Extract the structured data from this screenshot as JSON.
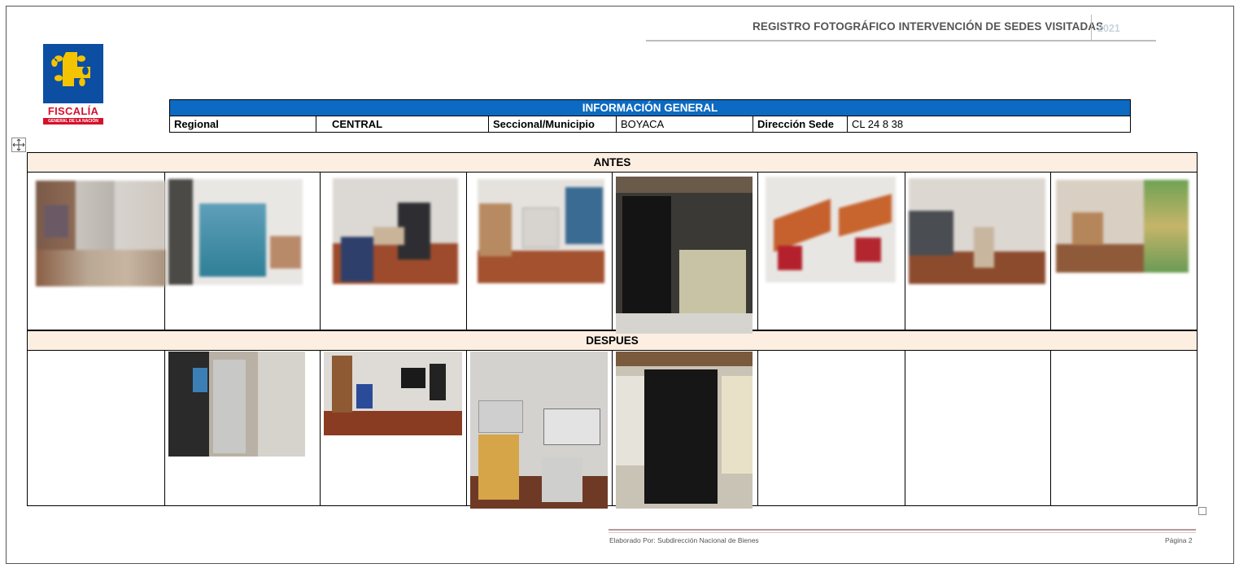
{
  "header": {
    "title": "REGISTRO FOTOGRÁFICO INTERVENCIÓN DE SEDES VISITADAS",
    "year": "2021"
  },
  "logo": {
    "name": "FISCALÍA",
    "subtitle": "GENERAL DE LA NACIÓN"
  },
  "info": {
    "title": "INFORMACIÓN GENERAL",
    "regional_label": "Regional",
    "regional_value": "CENTRAL",
    "seccional_label": "Seccional/Municipio",
    "seccional_value": "BOYACA",
    "direccion_label": "Dirección Sede",
    "direccion_value": "CL 24 8 38"
  },
  "sections": {
    "antes": "ANTES",
    "despues": "DESPUES"
  },
  "footer": {
    "elaborado": "Elaborado Por: Subdirección Nacional de Bienes",
    "pagina": "Página 2"
  },
  "colors": {
    "brand_blue": "#0b4ea2",
    "brand_red": "#d6112b",
    "brand_yellow": "#f5c400",
    "table_header_blue": "#0c6ac2",
    "band_peach": "#fdeee2"
  }
}
